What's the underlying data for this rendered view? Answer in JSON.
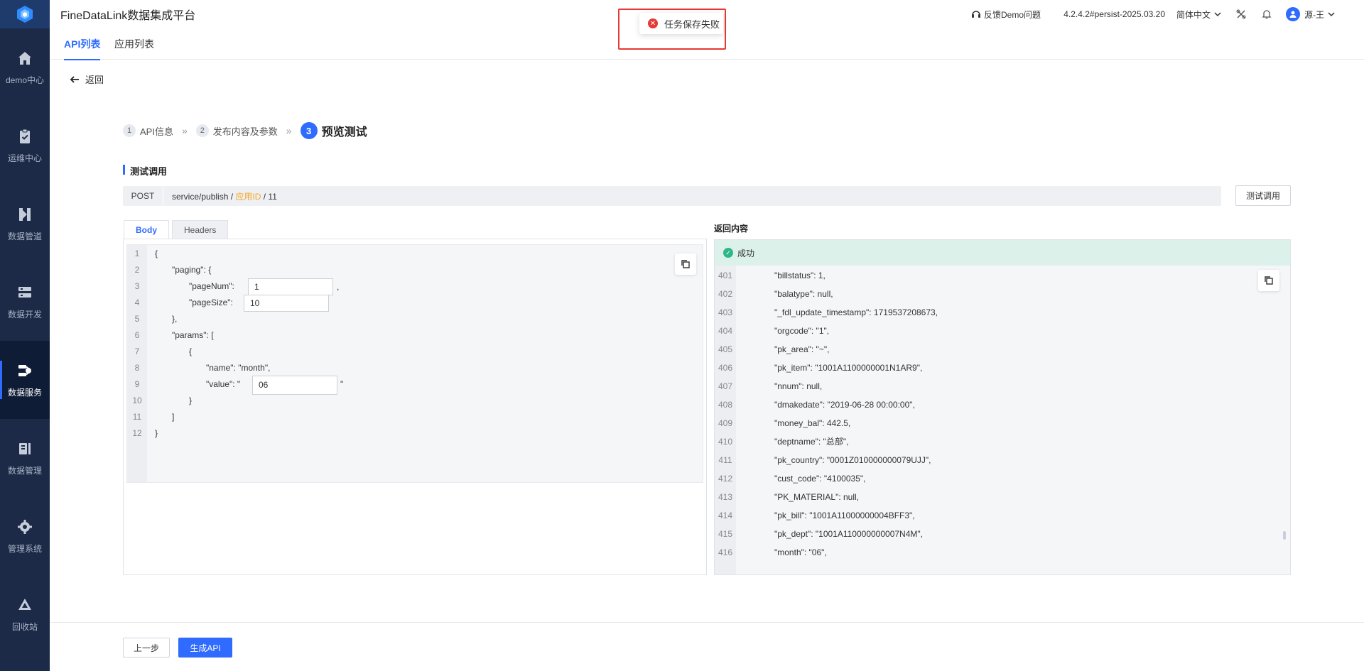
{
  "app": {
    "title": "FineDataLink数据集成平台"
  },
  "sidebar": {
    "items": [
      {
        "label": "demo中心",
        "icon": "home-icon"
      },
      {
        "label": "运维中心",
        "icon": "clipboard-check-icon"
      },
      {
        "label": "数据管道",
        "icon": "pipeline-icon"
      },
      {
        "label": "数据开发",
        "icon": "server-icon"
      },
      {
        "label": "数据服务",
        "icon": "service-icon",
        "active": true
      },
      {
        "label": "数据管理",
        "icon": "data-manage-icon"
      },
      {
        "label": "管理系统",
        "icon": "gear-icon"
      },
      {
        "label": "回收站",
        "icon": "recycle-icon"
      }
    ]
  },
  "header": {
    "feedback": "反馈Demo问题",
    "version": "4.2.4.2#persist-2025.03.20",
    "language": "简体中文",
    "user": "源-王"
  },
  "toast": {
    "message": "任务保存失败",
    "type": "error"
  },
  "tabs": [
    {
      "label": "API列表",
      "active": true
    },
    {
      "label": "应用列表",
      "active": false
    }
  ],
  "back_label": "返回",
  "steps": [
    {
      "num": "1",
      "label": "API信息"
    },
    {
      "num": "2",
      "label": "发布内容及参数"
    },
    {
      "num": "3",
      "label": "预览测试",
      "active": true
    }
  ],
  "section_title": "测试调用",
  "request": {
    "method": "POST",
    "url_prefix": "service/publish /",
    "url_highlight": "应用ID",
    "url_suffix": "/ 11",
    "test_button": "测试调用"
  },
  "body_tabs": [
    {
      "label": "Body",
      "active": true
    },
    {
      "label": "Headers",
      "active": false
    }
  ],
  "body_editor": {
    "lines": [
      {
        "n": "1",
        "text": "{"
      },
      {
        "n": "2",
        "text": "\"paging\": {"
      },
      {
        "n": "3",
        "text": "\"pageNum\":"
      },
      {
        "n": "4",
        "text": "\"pageSize\":"
      },
      {
        "n": "5",
        "text": "},"
      },
      {
        "n": "6",
        "text": "\"params\": ["
      },
      {
        "n": "7",
        "text": "{"
      },
      {
        "n": "8",
        "text": "\"name\": \"month\","
      },
      {
        "n": "9",
        "text": "\"value\":  \""
      },
      {
        "n": "10",
        "text": "}"
      },
      {
        "n": "11",
        "text": "]"
      },
      {
        "n": "12",
        "text": "}"
      }
    ],
    "pageNum_value": "1",
    "pageSize_value": "10",
    "month_value": "06",
    "comma": ",",
    "quote": "\""
  },
  "response": {
    "title": "返回内容",
    "status": "成功",
    "lines": [
      {
        "n": "401",
        "text": "\"billstatus\": 1,"
      },
      {
        "n": "402",
        "text": "\"balatype\": null,"
      },
      {
        "n": "403",
        "text": "\"_fdl_update_timestamp\": 1719537208673,"
      },
      {
        "n": "404",
        "text": "\"orgcode\": \"1\","
      },
      {
        "n": "405",
        "text": "\"pk_area\": \"~\","
      },
      {
        "n": "406",
        "text": "\"pk_item\": \"1001A1100000001N1AR9\","
      },
      {
        "n": "407",
        "text": "\"nnum\": null,"
      },
      {
        "n": "408",
        "text": "\"dmakedate\": \"2019-06-28 00:00:00\","
      },
      {
        "n": "409",
        "text": "\"money_bal\": 442.5,"
      },
      {
        "n": "410",
        "text": "\"deptname\": \"总部\","
      },
      {
        "n": "411",
        "text": "\"pk_country\": \"0001Z010000000079UJJ\","
      },
      {
        "n": "412",
        "text": "\"cust_code\": \"4100035\","
      },
      {
        "n": "413",
        "text": "\"PK_MATERIAL\": null,"
      },
      {
        "n": "414",
        "text": "\"pk_bill\": \"1001A11000000004BFF3\","
      },
      {
        "n": "415",
        "text": "\"pk_dept\": \"1001A110000000007N4M\","
      },
      {
        "n": "416",
        "text": "\"month\": \"06\","
      }
    ]
  },
  "footer": {
    "prev": "上一步",
    "generate": "生成API"
  }
}
